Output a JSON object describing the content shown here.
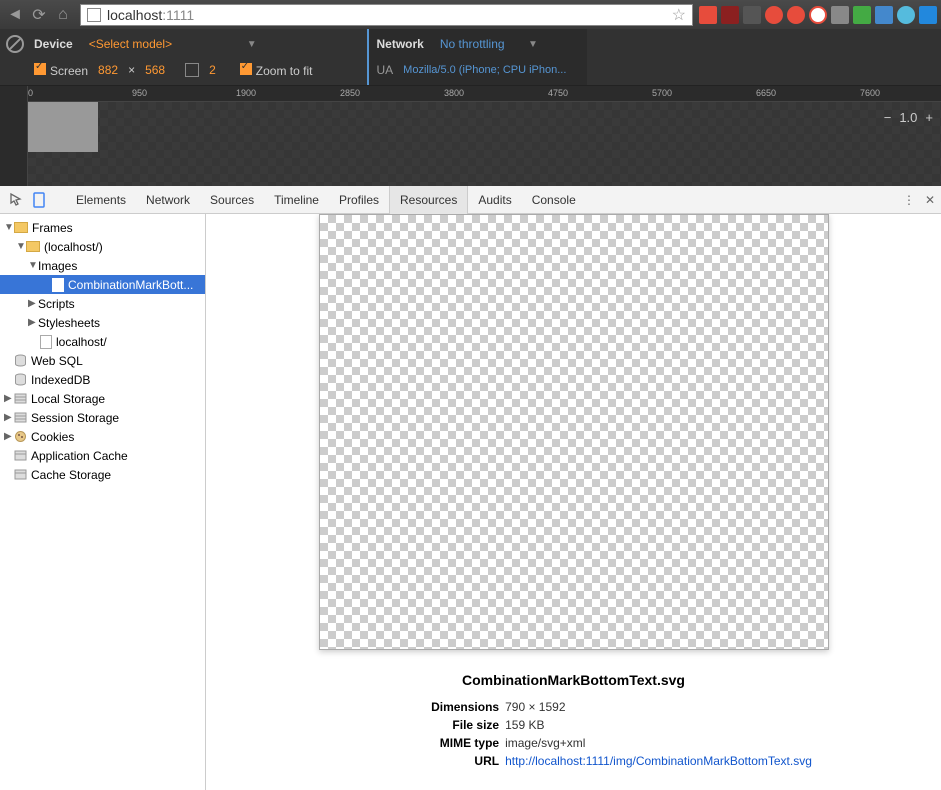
{
  "browser": {
    "url_host": "localhost",
    "url_port": ":1111"
  },
  "device": {
    "device_label": "Device",
    "select_model": "<Select model>",
    "screen_label": "Screen",
    "width": "882",
    "times": "×",
    "height": "568",
    "dpr": "2",
    "zoom_fit": "Zoom to fit"
  },
  "network": {
    "label": "Network",
    "throttling": "No throttling",
    "ua_label": "UA",
    "ua_value": "Mozilla/5.0 (iPhone; CPU iPhon..."
  },
  "ruler": {
    "ticks": [
      "0",
      "950",
      "1900",
      "2850",
      "3800",
      "4750",
      "5700",
      "6650",
      "7600"
    ],
    "zoom": "1.0"
  },
  "tabs": {
    "items": [
      "Elements",
      "Network",
      "Sources",
      "Timeline",
      "Profiles",
      "Resources",
      "Audits",
      "Console"
    ],
    "active": "Resources"
  },
  "tree": {
    "frames": "Frames",
    "localhost": "(localhost/)",
    "images": "Images",
    "selected_file": "CombinationMarkBott...",
    "scripts": "Scripts",
    "stylesheets": "Stylesheets",
    "localhost_file": "localhost/",
    "websql": "Web SQL",
    "indexeddb": "IndexedDB",
    "localstorage": "Local Storage",
    "sessionstorage": "Session Storage",
    "cookies": "Cookies",
    "appcache": "Application Cache",
    "cachestorage": "Cache Storage"
  },
  "preview": {
    "filename": "CombinationMarkBottomText.svg",
    "dim_label": "Dimensions",
    "dim_value": "790 × 1592",
    "size_label": "File size",
    "size_value": "159 KB",
    "mime_label": "MIME type",
    "mime_value": "image/svg+xml",
    "url_label": "URL",
    "url_value": "http://localhost:1111/img/CombinationMarkBottomText.svg"
  }
}
